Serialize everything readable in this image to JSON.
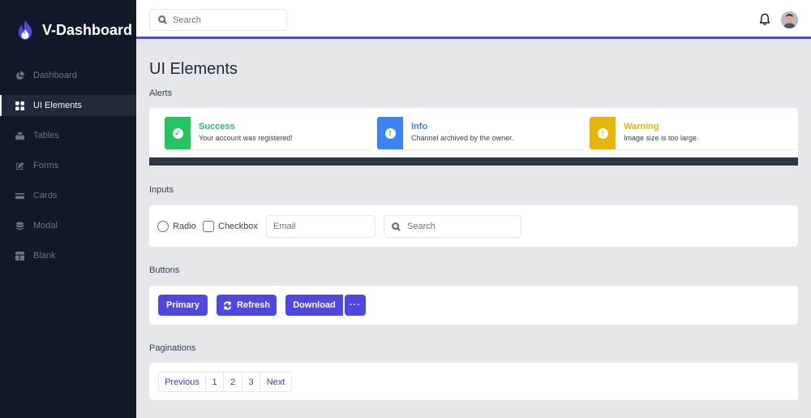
{
  "brand": {
    "title": "V-Dashboard",
    "color": "#4f46e5"
  },
  "header": {
    "search_placeholder": "Search",
    "bell_icon": "bell-icon",
    "accent": "#4f46e5"
  },
  "sidebar": {
    "items": [
      {
        "label": "Dashboard",
        "icon": "pie-chart-icon",
        "active": false
      },
      {
        "label": "UI Elements",
        "icon": "grid-icon",
        "active": true
      },
      {
        "label": "Tables",
        "icon": "table-icon",
        "active": false
      },
      {
        "label": "Forms",
        "icon": "edit-icon",
        "active": false
      },
      {
        "label": "Cards",
        "icon": "credit-card-icon",
        "active": false
      },
      {
        "label": "Modal",
        "icon": "database-icon",
        "active": false
      },
      {
        "label": "Blank",
        "icon": "layout-icon",
        "active": false
      }
    ]
  },
  "main": {
    "title": "UI Elements",
    "sections": {
      "alerts": "Alerts",
      "inputs": "Inputs",
      "buttons": "Buttons",
      "paginations": "Paginations"
    },
    "alerts": [
      {
        "title": "Success",
        "text": "Your account was registered!",
        "color": "#22c55e",
        "icon": "check-circle-icon",
        "glyph": "✓"
      },
      {
        "title": "Info",
        "text": "Channel archived by the owner.",
        "color": "#3b82f6",
        "icon": "info-circle-icon",
        "glyph": "!"
      },
      {
        "title": "Warning",
        "text": "Image size is too large.",
        "color": "#eab308",
        "icon": "warning-circle-icon",
        "glyph": "!"
      }
    ],
    "inputs": {
      "radio_label": "Radio",
      "checkbox_label": "Checkbox",
      "email_placeholder": "Email",
      "search_placeholder": "Search"
    },
    "buttons": {
      "primary": "Primary",
      "refresh": "Refresh",
      "download": "Download",
      "more": "···"
    },
    "pagination": [
      "Previous",
      "1",
      "2",
      "3",
      "Next"
    ]
  }
}
